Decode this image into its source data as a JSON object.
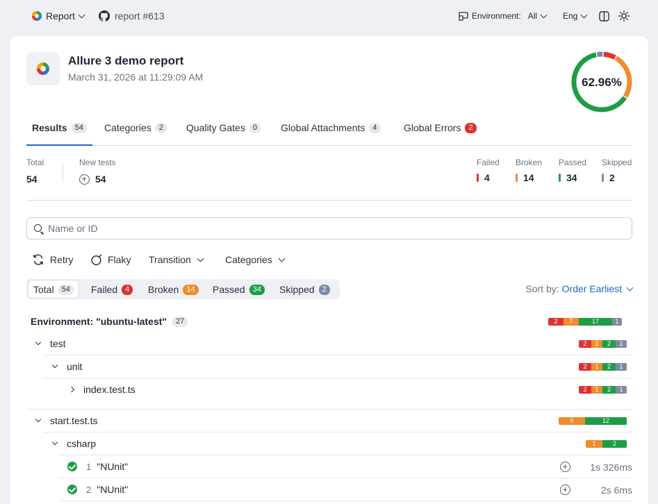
{
  "topbar": {
    "report_menu": "Report",
    "repo_link": "report #613",
    "environment_label": "Environment:",
    "environment_value": "All",
    "language": "Eng"
  },
  "report": {
    "title": "Allure 3 demo report",
    "date": "March 31, 2026 at 11:29:09 AM",
    "pass_rate": "62.96%"
  },
  "donut": {
    "segments": [
      {
        "status": "failed",
        "value": 4,
        "color": "#e03131"
      },
      {
        "status": "broken",
        "value": 14,
        "color": "#f08c2c"
      },
      {
        "status": "passed",
        "value": 34,
        "color": "#1e9d46"
      },
      {
        "status": "skipped",
        "value": 2,
        "color": "#7d8aa3"
      }
    ]
  },
  "tabs": [
    {
      "label": "Results",
      "count": "54"
    },
    {
      "label": "Categories",
      "count": "2"
    },
    {
      "label": "Quality Gates",
      "count": "0"
    },
    {
      "label": "Global Attachments",
      "count": "4"
    },
    {
      "label": "Global Errors",
      "count": "2"
    }
  ],
  "summary": {
    "total_label": "Total",
    "total_value": "54",
    "new_tests_label": "New tests",
    "new_tests_value": "54",
    "statuses": [
      {
        "label": "Failed",
        "value": "4",
        "color": "#e03131"
      },
      {
        "label": "Broken",
        "value": "14",
        "color": "#f08c2c"
      },
      {
        "label": "Passed",
        "value": "34",
        "color": "#1e9d46"
      },
      {
        "label": "Skipped",
        "value": "2",
        "color": "#7d8aa3"
      }
    ]
  },
  "search": {
    "placeholder": "Name or ID"
  },
  "actions": {
    "retry": "Retry",
    "flaky": "Flaky",
    "transition": "Transition",
    "categories": "Categories"
  },
  "filters": [
    {
      "label": "Total",
      "count": "54"
    },
    {
      "label": "Failed",
      "count": "4"
    },
    {
      "label": "Broken",
      "count": "14"
    },
    {
      "label": "Passed",
      "count": "34"
    },
    {
      "label": "Skipped",
      "count": "2"
    }
  ],
  "sort": {
    "label": "Sort by:",
    "value": "Order Earliest"
  },
  "tree": {
    "env_label": "Environment: \"ubuntu-latest\"",
    "env_count": "27",
    "env_bar": [
      "2",
      "7",
      "17",
      "1"
    ],
    "test": {
      "name": "test",
      "bar": [
        "2",
        "1",
        "2",
        "1"
      ]
    },
    "unit": {
      "name": "unit",
      "bar": [
        "2",
        "1",
        "2",
        "1"
      ]
    },
    "index": {
      "name": "index.test.ts",
      "bar": [
        "2",
        "1",
        "2",
        "1"
      ]
    },
    "start": {
      "name": "start.test.ts",
      "bar": [
        "6",
        "12"
      ]
    },
    "csharp": {
      "name": "csharp",
      "bar": [
        "1",
        "2"
      ]
    },
    "leaves": [
      {
        "num": "1",
        "name": "\"NUnit\"",
        "duration": "1s 326ms"
      },
      {
        "num": "2",
        "name": "\"NUnit\"",
        "duration": "2s 6ms"
      }
    ]
  }
}
